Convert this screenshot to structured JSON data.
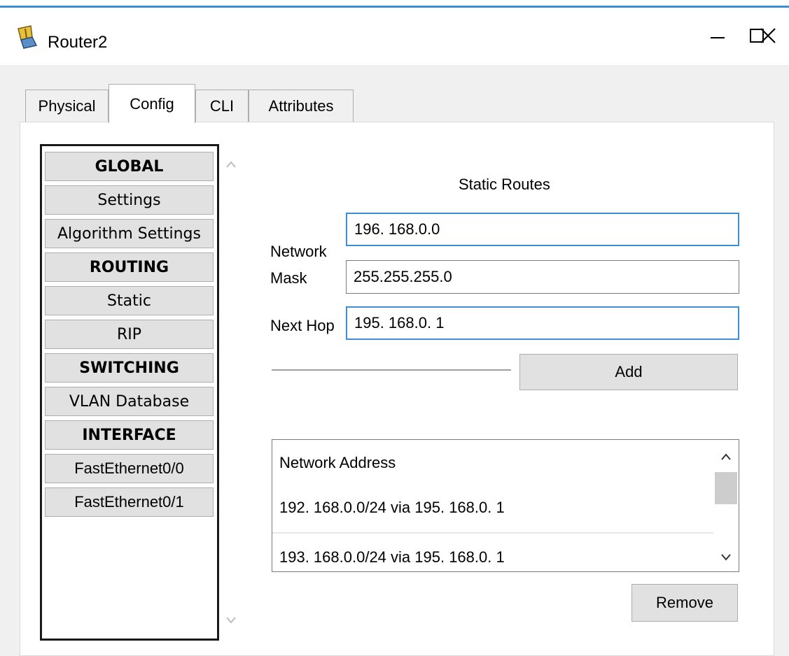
{
  "window": {
    "title": "Router2",
    "app_icon": "router-icon",
    "controls": {
      "minimize_icon": "minimize-icon",
      "maximize_icon": "maximize-icon",
      "close_icon": "close-icon"
    }
  },
  "tabs": [
    {
      "label": "Physical",
      "active": false
    },
    {
      "label": "Config",
      "active": true
    },
    {
      "label": "CLI",
      "active": false
    },
    {
      "label": "Attributes",
      "active": false
    }
  ],
  "sidebar": {
    "items": [
      {
        "label": "GLOBAL",
        "kind": "header"
      },
      {
        "label": "Settings",
        "kind": "item"
      },
      {
        "label": "Algorithm Settings",
        "kind": "item"
      },
      {
        "label": "ROUTING",
        "kind": "header"
      },
      {
        "label": "Static",
        "kind": "item"
      },
      {
        "label": "RIP",
        "kind": "item"
      },
      {
        "label": "SWITCHING",
        "kind": "header"
      },
      {
        "label": "VLAN Database",
        "kind": "item"
      },
      {
        "label": "INTERFACE",
        "kind": "header"
      },
      {
        "label": "FastEthernet0/0",
        "kind": "item"
      },
      {
        "label": "FastEthernet0/1",
        "kind": "item"
      }
    ]
  },
  "static_routes": {
    "title": "Static Routes",
    "network_label": "Network",
    "network_value": "196. 168.0.0",
    "mask_label": "Mask",
    "mask_value": "255.255.255.0",
    "next_hop_label": "Next Hop",
    "next_hop_value": "195. 168.0. 1",
    "add_label": "Add",
    "list_header": "Network Address",
    "routes": [
      "192. 168.0.0/24 via 195. 168.0. 1",
      "193. 168.0.0/24 via 195. 168.0. 1"
    ],
    "remove_label": "Remove"
  },
  "colors": {
    "focus_border": "#3c8fd6",
    "button_face": "#e1e1e1",
    "window_bg": "#f0f0f0"
  }
}
